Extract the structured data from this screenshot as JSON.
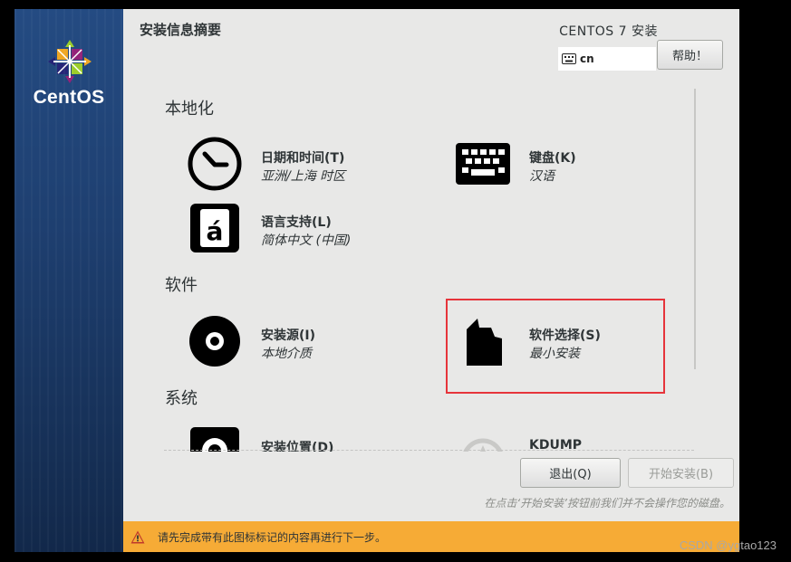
{
  "brand": {
    "name": "CentOS"
  },
  "header": {
    "hub_title": "安装信息摘要",
    "product_title": "CENTOS 7 安装",
    "keyboard_layout": "cn",
    "help_label": "帮助！"
  },
  "sections": {
    "localization": {
      "title": "本地化",
      "spokes": {
        "datetime": {
          "name": "日期和时间(T)",
          "status": "亚洲/上海 时区",
          "icon": "clock-icon"
        },
        "keyboard": {
          "name": "键盘(K)",
          "status": "汉语",
          "icon": "keyboard-icon"
        },
        "language": {
          "name": "语言支持(L)",
          "status": "简体中文 (中国)",
          "icon": "language-icon"
        }
      }
    },
    "software": {
      "title": "软件",
      "spokes": {
        "source": {
          "name": "安装源(I)",
          "status": "本地介质",
          "icon": "disc-icon"
        },
        "selection": {
          "name": "软件选择(S)",
          "status": "最小安装",
          "icon": "package-icon"
        }
      }
    },
    "system": {
      "title": "系统",
      "spokes": {
        "destination": {
          "name": "安装位置(D)",
          "icon": "harddisk-icon"
        },
        "kdump": {
          "name": "KDUMP",
          "icon": "kdump-icon"
        }
      }
    }
  },
  "footer": {
    "quit_label": "退出(Q)",
    "begin_label": "开始安装(B)",
    "hint": "在点击‘开始安装’按钮前我们并不会操作您的磁盘。"
  },
  "warning": {
    "text": "请先完成带有此图标标记的内容再进行下一步。",
    "icon": "warning-icon",
    "color": "#f6ab36"
  },
  "watermark": "CSDN @ygtao123",
  "colors": {
    "sidebar": "#1e3f70",
    "highlight": "#e6343b",
    "background": "#e8e8e7"
  }
}
